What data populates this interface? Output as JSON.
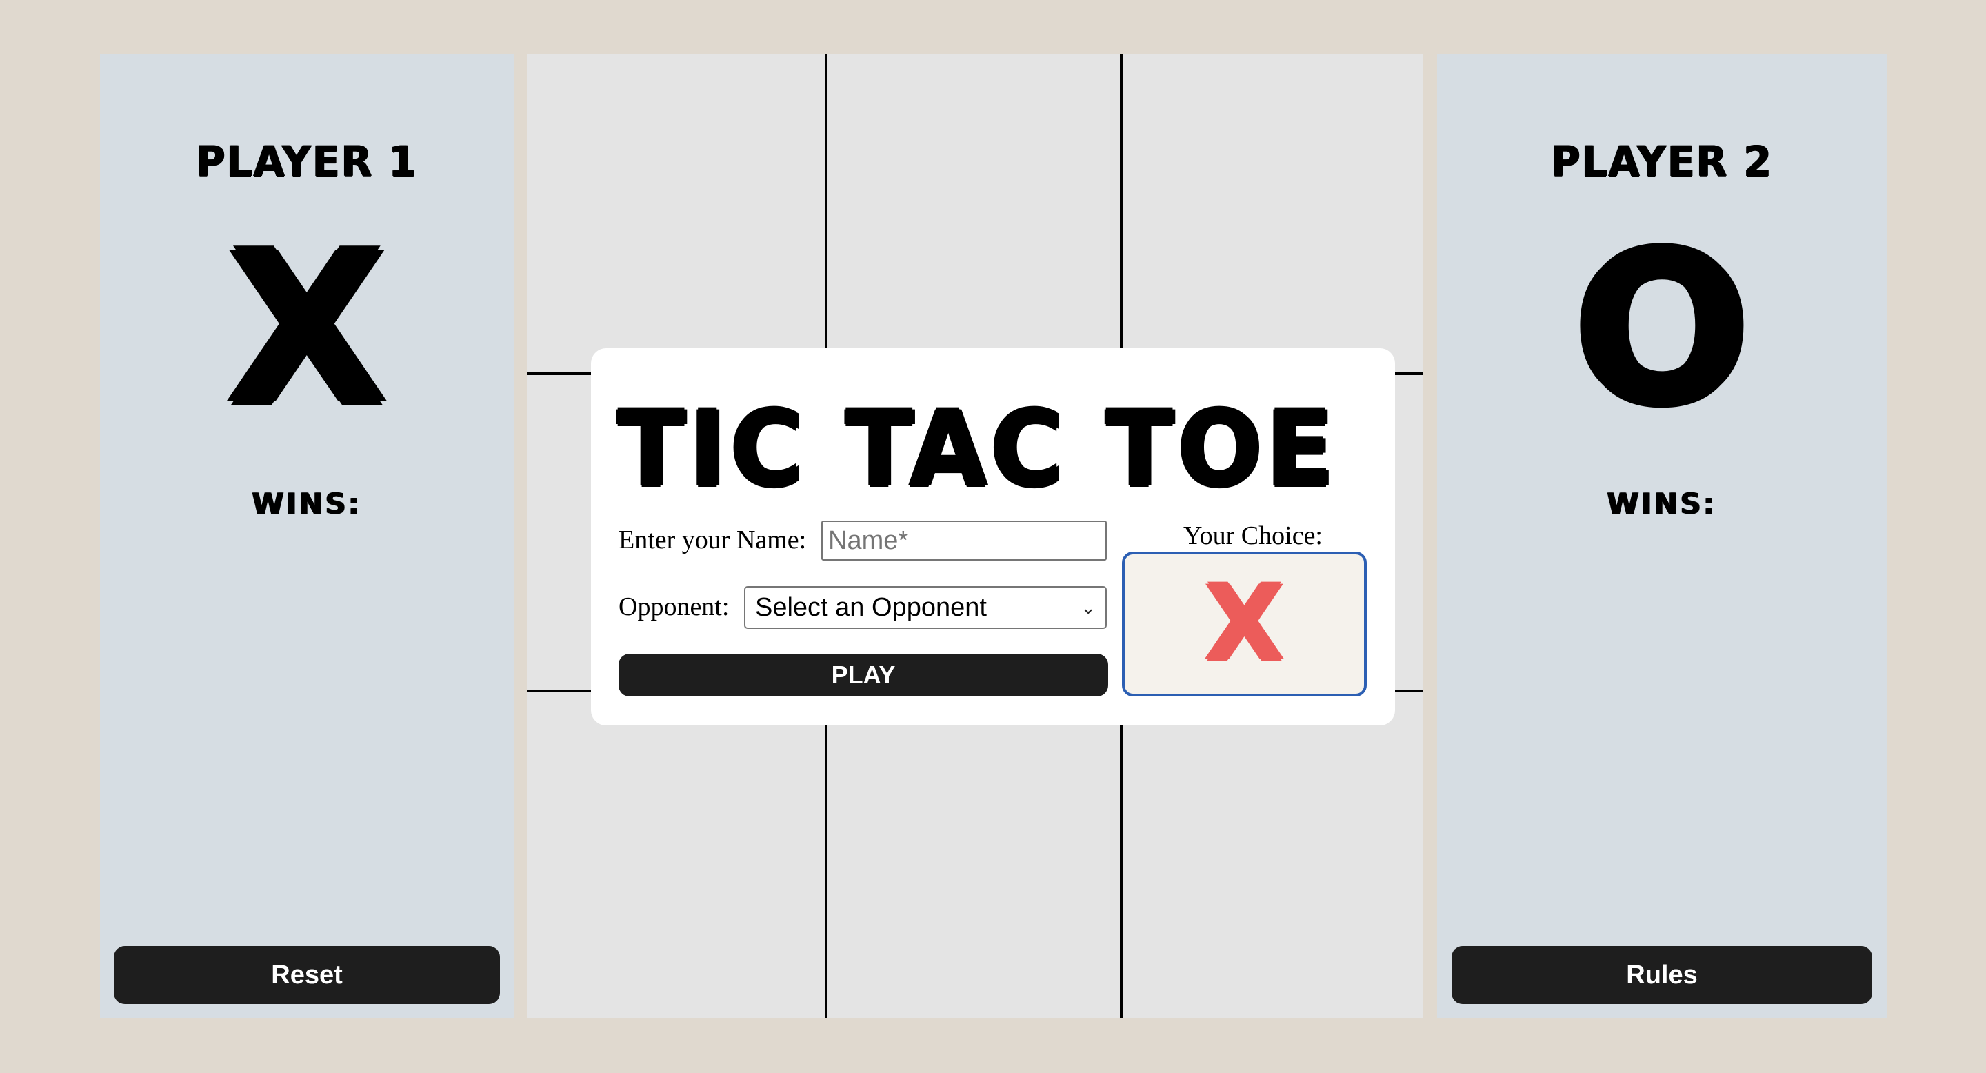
{
  "player1": {
    "title": "PLAYER 1",
    "symbol": "X",
    "wins_label": "WINS:",
    "button_label": "Reset"
  },
  "player2": {
    "title": "PLAYER 2",
    "symbol": "O",
    "wins_label": "WINS:",
    "button_label": "Rules"
  },
  "modal": {
    "title": "TIC TAC TOE",
    "name_label": "Enter your Name:",
    "name_placeholder": "Name*",
    "name_value": "",
    "opponent_label": "Opponent:",
    "opponent_selected": "Select an Opponent",
    "play_label": "PLAY",
    "choice_label": "Your Choice:",
    "choice_symbol": "X"
  },
  "colors": {
    "background": "#e0d9cf",
    "panel": "#d6dde3",
    "board_cell": "#e4e4e4",
    "button": "#1e1e1e",
    "choice_accent": "#ec5c5a",
    "choice_border": "#2c5fb3"
  },
  "icons": {
    "select_chevron": "chevron-down-icon"
  }
}
